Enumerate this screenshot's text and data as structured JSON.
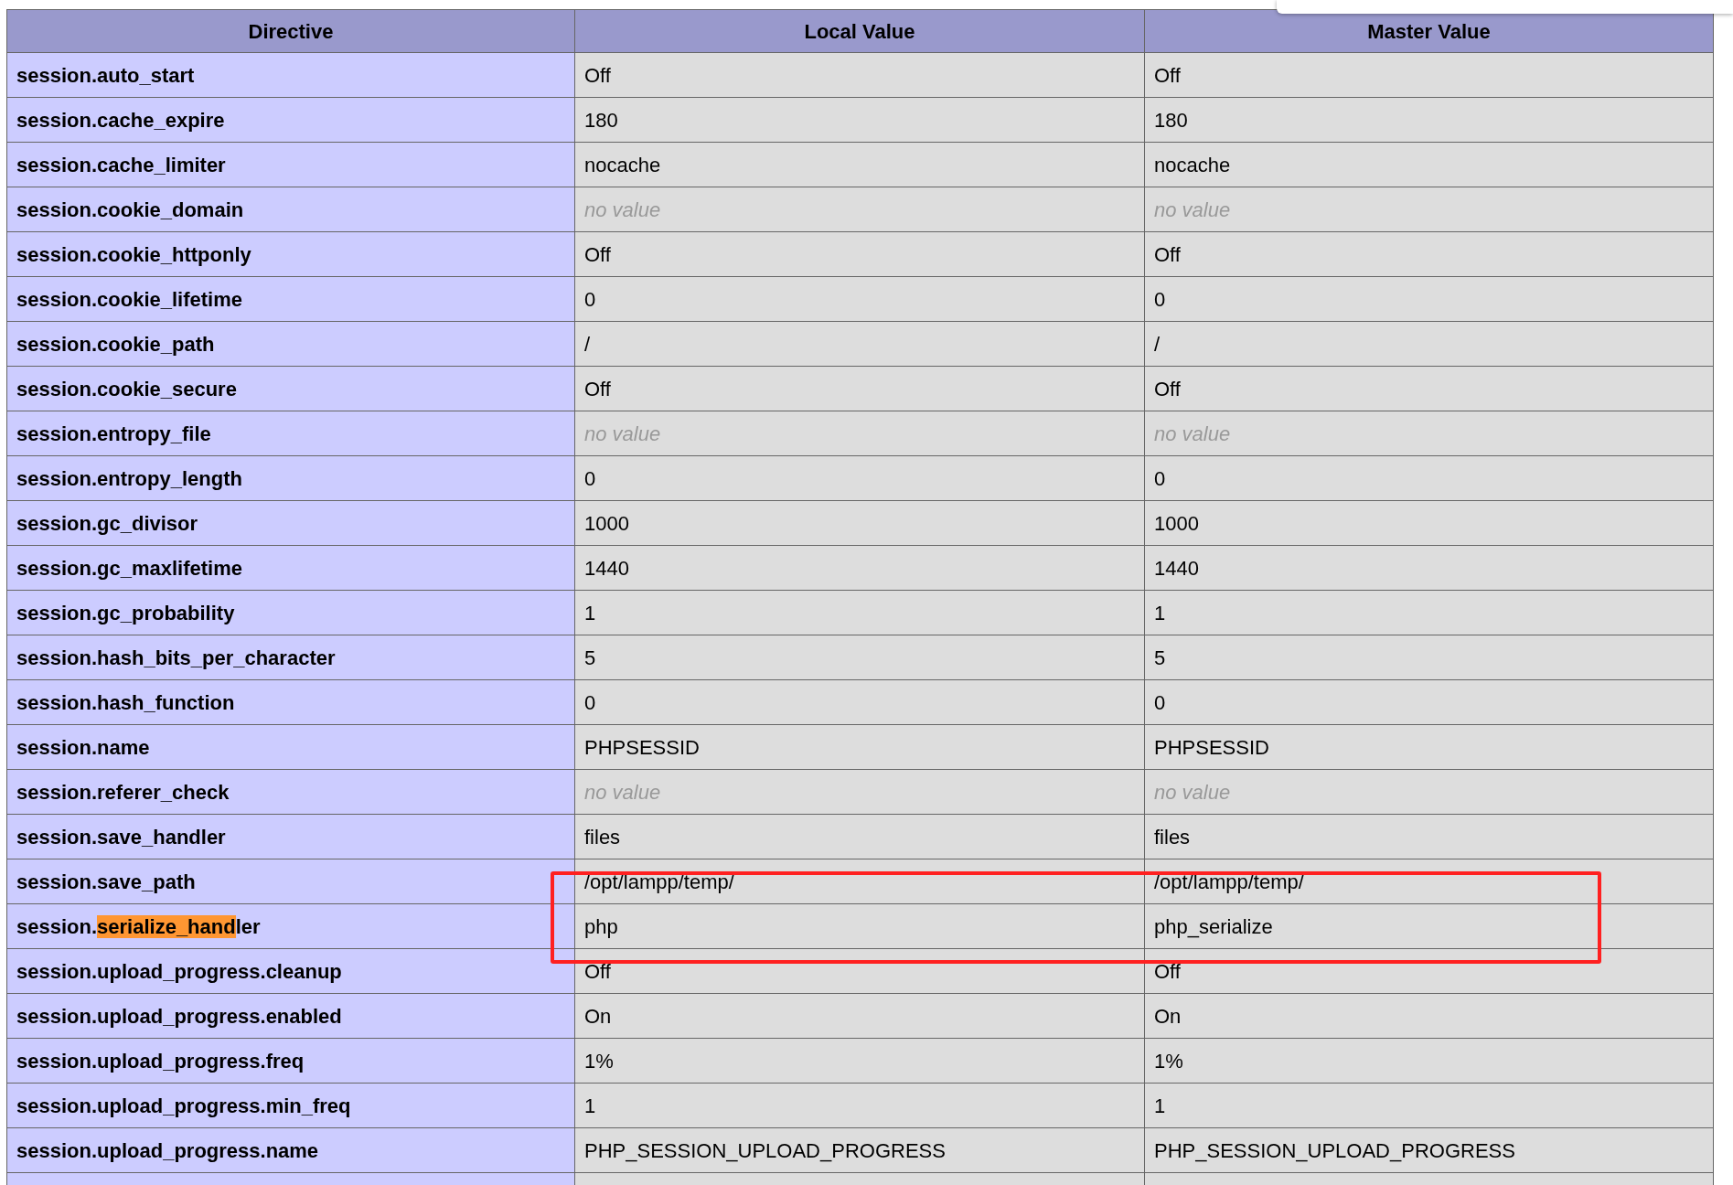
{
  "columns": [
    "Directive",
    "Local Value",
    "Master Value"
  ],
  "rows": [
    {
      "directive": [
        {
          "text": "session.auto_start",
          "highlighted": false
        }
      ],
      "local": {
        "text": "Off",
        "kind": "value"
      },
      "master": {
        "text": "Off",
        "kind": "value"
      }
    },
    {
      "directive": [
        {
          "text": "session.cache_expire",
          "highlighted": false
        }
      ],
      "local": {
        "text": "180",
        "kind": "value"
      },
      "master": {
        "text": "180",
        "kind": "value"
      }
    },
    {
      "directive": [
        {
          "text": "session.cache_limiter",
          "highlighted": false
        }
      ],
      "local": {
        "text": "nocache",
        "kind": "value"
      },
      "master": {
        "text": "nocache",
        "kind": "value"
      }
    },
    {
      "directive": [
        {
          "text": "session.cookie_domain",
          "highlighted": false
        }
      ],
      "local": {
        "text": "no value",
        "kind": "none"
      },
      "master": {
        "text": "no value",
        "kind": "none"
      }
    },
    {
      "directive": [
        {
          "text": "session.cookie_httponly",
          "highlighted": false
        }
      ],
      "local": {
        "text": "Off",
        "kind": "value"
      },
      "master": {
        "text": "Off",
        "kind": "value"
      }
    },
    {
      "directive": [
        {
          "text": "session.cookie_lifetime",
          "highlighted": false
        }
      ],
      "local": {
        "text": "0",
        "kind": "value"
      },
      "master": {
        "text": "0",
        "kind": "value"
      }
    },
    {
      "directive": [
        {
          "text": "session.cookie_path",
          "highlighted": false
        }
      ],
      "local": {
        "text": "/",
        "kind": "value"
      },
      "master": {
        "text": "/",
        "kind": "value"
      }
    },
    {
      "directive": [
        {
          "text": "session.cookie_secure",
          "highlighted": false
        }
      ],
      "local": {
        "text": "Off",
        "kind": "value"
      },
      "master": {
        "text": "Off",
        "kind": "value"
      }
    },
    {
      "directive": [
        {
          "text": "session.entropy_file",
          "highlighted": false
        }
      ],
      "local": {
        "text": "no value",
        "kind": "none"
      },
      "master": {
        "text": "no value",
        "kind": "none"
      }
    },
    {
      "directive": [
        {
          "text": "session.entropy_length",
          "highlighted": false
        }
      ],
      "local": {
        "text": "0",
        "kind": "value"
      },
      "master": {
        "text": "0",
        "kind": "value"
      }
    },
    {
      "directive": [
        {
          "text": "session.gc_divisor",
          "highlighted": false
        }
      ],
      "local": {
        "text": "1000",
        "kind": "value"
      },
      "master": {
        "text": "1000",
        "kind": "value"
      }
    },
    {
      "directive": [
        {
          "text": "session.gc_maxlifetime",
          "highlighted": false
        }
      ],
      "local": {
        "text": "1440",
        "kind": "value"
      },
      "master": {
        "text": "1440",
        "kind": "value"
      }
    },
    {
      "directive": [
        {
          "text": "session.gc_probability",
          "highlighted": false
        }
      ],
      "local": {
        "text": "1",
        "kind": "value"
      },
      "master": {
        "text": "1",
        "kind": "value"
      }
    },
    {
      "directive": [
        {
          "text": "session.hash_bits_per_character",
          "highlighted": false
        }
      ],
      "local": {
        "text": "5",
        "kind": "value"
      },
      "master": {
        "text": "5",
        "kind": "value"
      }
    },
    {
      "directive": [
        {
          "text": "session.hash_function",
          "highlighted": false
        }
      ],
      "local": {
        "text": "0",
        "kind": "value"
      },
      "master": {
        "text": "0",
        "kind": "value"
      }
    },
    {
      "directive": [
        {
          "text": "session.name",
          "highlighted": false
        }
      ],
      "local": {
        "text": "PHPSESSID",
        "kind": "value"
      },
      "master": {
        "text": "PHPSESSID",
        "kind": "value"
      }
    },
    {
      "directive": [
        {
          "text": "session.referer_check",
          "highlighted": false
        }
      ],
      "local": {
        "text": "no value",
        "kind": "none"
      },
      "master": {
        "text": "no value",
        "kind": "none"
      }
    },
    {
      "directive": [
        {
          "text": "session.save_handler",
          "highlighted": false
        }
      ],
      "local": {
        "text": "files",
        "kind": "value"
      },
      "master": {
        "text": "files",
        "kind": "value"
      }
    },
    {
      "directive": [
        {
          "text": "session.save_path",
          "highlighted": false
        }
      ],
      "local": {
        "text": "/opt/lampp/temp/",
        "kind": "value"
      },
      "master": {
        "text": "/opt/lampp/temp/",
        "kind": "value"
      }
    },
    {
      "directive": [
        {
          "text": "session.",
          "highlighted": false
        },
        {
          "text": "serialize_hand",
          "highlighted": true
        },
        {
          "text": "ler",
          "highlighted": false
        }
      ],
      "local": {
        "text": "php",
        "kind": "value"
      },
      "master": {
        "text": "php_serialize",
        "kind": "value"
      }
    },
    {
      "directive": [
        {
          "text": "session.upload_progress.cleanup",
          "highlighted": false
        }
      ],
      "local": {
        "text": "Off",
        "kind": "value"
      },
      "master": {
        "text": "Off",
        "kind": "value"
      }
    },
    {
      "directive": [
        {
          "text": "session.upload_progress.enabled",
          "highlighted": false
        }
      ],
      "local": {
        "text": "On",
        "kind": "value"
      },
      "master": {
        "text": "On",
        "kind": "value"
      }
    },
    {
      "directive": [
        {
          "text": "session.upload_progress.freq",
          "highlighted": false
        }
      ],
      "local": {
        "text": "1%",
        "kind": "value"
      },
      "master": {
        "text": "1%",
        "kind": "value"
      }
    },
    {
      "directive": [
        {
          "text": "session.upload_progress.min_freq",
          "highlighted": false
        }
      ],
      "local": {
        "text": "1",
        "kind": "value"
      },
      "master": {
        "text": "1",
        "kind": "value"
      }
    },
    {
      "directive": [
        {
          "text": "session.upload_progress.name",
          "highlighted": false
        }
      ],
      "local": {
        "text": "PHP_SESSION_UPLOAD_PROGRESS",
        "kind": "value"
      },
      "master": {
        "text": "PHP_SESSION_UPLOAD_PROGRESS",
        "kind": "value"
      }
    }
  ],
  "annotation": {
    "color": "#ff2020"
  }
}
